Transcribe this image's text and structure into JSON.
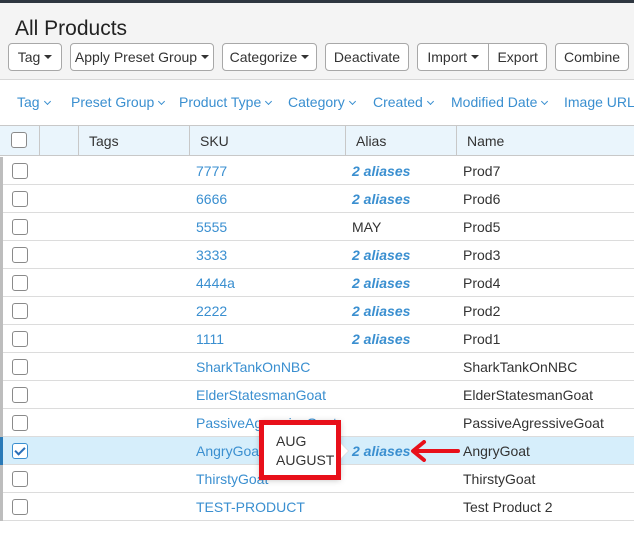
{
  "page": {
    "title": "All Products"
  },
  "toolbar": {
    "tag": "Tag",
    "apply_preset_group": "Apply Preset Group",
    "categorize": "Categorize",
    "deactivate": "Deactivate",
    "import": "Import",
    "export": "Export",
    "combine": "Combine"
  },
  "filters": [
    "Tag",
    "Preset Group",
    "Product Type",
    "Category",
    "Created",
    "Modified Date",
    "Image URL"
  ],
  "table": {
    "headers": {
      "tags": "Tags",
      "sku": "SKU",
      "alias": "Alias",
      "name": "Name"
    },
    "rows": [
      {
        "sku": "7777",
        "alias": "2 aliases",
        "alias_link": true,
        "name": "Prod7",
        "checked": false
      },
      {
        "sku": "6666",
        "alias": "2 aliases",
        "alias_link": true,
        "name": "Prod6",
        "checked": false
      },
      {
        "sku": "5555",
        "alias": "MAY",
        "alias_link": false,
        "name": "Prod5",
        "checked": false
      },
      {
        "sku": "3333",
        "alias": "2 aliases",
        "alias_link": true,
        "name": "Prod3",
        "checked": false
      },
      {
        "sku": "4444a",
        "alias": "2 aliases",
        "alias_link": true,
        "name": "Prod4",
        "checked": false
      },
      {
        "sku": "2222",
        "alias": "2 aliases",
        "alias_link": true,
        "name": "Prod2",
        "checked": false
      },
      {
        "sku": "1111",
        "alias": "2 aliases",
        "alias_link": true,
        "name": "Prod1",
        "checked": false
      },
      {
        "sku": "SharkTankOnNBC",
        "alias": "",
        "alias_link": false,
        "name": "SharkTankOnNBC",
        "checked": false
      },
      {
        "sku": "ElderStatesmanGoat",
        "alias": "",
        "alias_link": false,
        "name": "ElderStatesmanGoat",
        "checked": false
      },
      {
        "sku": "PassiveAgressiveGoat",
        "alias": "",
        "alias_link": false,
        "name": "PassiveAgressiveGoat",
        "checked": false
      },
      {
        "sku": "AngryGoat",
        "alias": "2 aliases",
        "alias_link": true,
        "name": "AngryGoat",
        "checked": true
      },
      {
        "sku": "ThirstyGoat",
        "alias": "",
        "alias_link": false,
        "name": "ThirstyGoat",
        "checked": false
      },
      {
        "sku": "TEST-PRODUCT",
        "alias": "",
        "alias_link": false,
        "name": "Test Product 2",
        "checked": false
      }
    ]
  },
  "popover": {
    "aliases": [
      "AUG",
      "AUGUST"
    ]
  },
  "colors": {
    "link": "#3a8fd0",
    "selected_row": "#d6eefb",
    "annotation": "#e8101a",
    "header_bg": "#eaf5fc"
  }
}
